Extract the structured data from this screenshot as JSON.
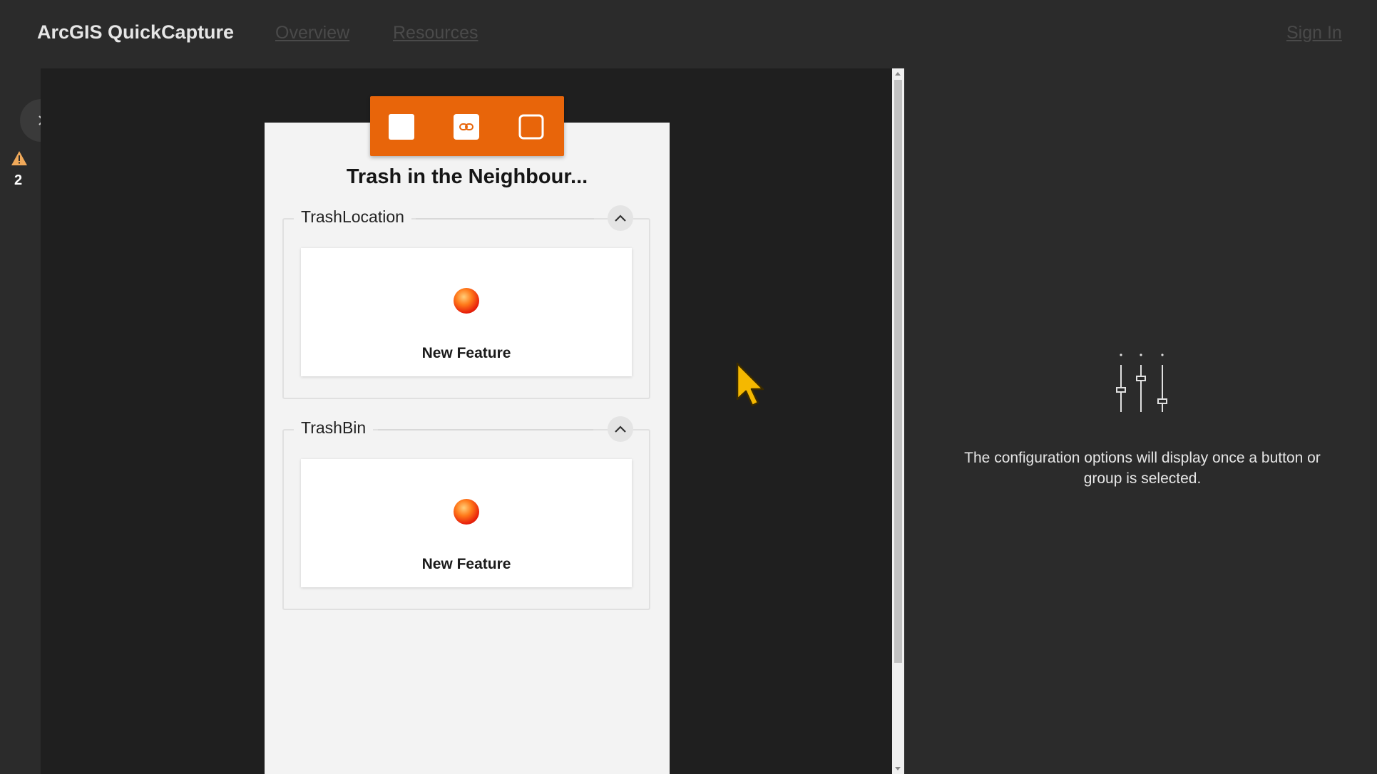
{
  "header": {
    "app_title": "ArcGIS QuickCapture",
    "nav": [
      {
        "label": "Overview"
      },
      {
        "label": "Resources"
      }
    ],
    "sign_in": "Sign In"
  },
  "sidebar": {
    "expand_icon": "chevron-right-icon",
    "warning_icon": "warning-icon",
    "warning_count": "2"
  },
  "toolbar": {
    "buttons": [
      {
        "icon": "square-icon"
      },
      {
        "icon": "link-icon"
      },
      {
        "icon": "rounded-square-icon"
      }
    ],
    "color": "#e8650a"
  },
  "project": {
    "title": "Trash in the Neighbour...",
    "groups": [
      {
        "label": "TrashLocation",
        "button": {
          "label": "New Feature"
        }
      },
      {
        "label": "TrashBin",
        "button": {
          "label": "New Feature"
        }
      }
    ]
  },
  "config_panel": {
    "icon": "sliders-icon",
    "message": "The configuration options will display once a button or group is selected."
  }
}
